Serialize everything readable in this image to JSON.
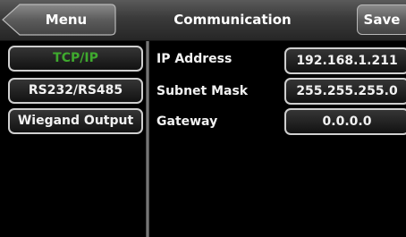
{
  "header": {
    "back_label": "Menu",
    "title": "Communication",
    "save_label": "Save"
  },
  "sidebar": {
    "items": [
      {
        "label": "TCP/IP",
        "active": true
      },
      {
        "label": "RS232/RS485",
        "active": false
      },
      {
        "label": "Wiegand Output",
        "active": false
      }
    ]
  },
  "settings": {
    "rows": [
      {
        "label": "IP Address",
        "value": "192.168.1.211"
      },
      {
        "label": "Subnet Mask",
        "value": "255.255.255.0"
      },
      {
        "label": "Gateway",
        "value": "0.0.0.0"
      }
    ]
  },
  "colors": {
    "active_item": "#3faa2e",
    "background": "#000000",
    "header": "#3a3a3a"
  }
}
